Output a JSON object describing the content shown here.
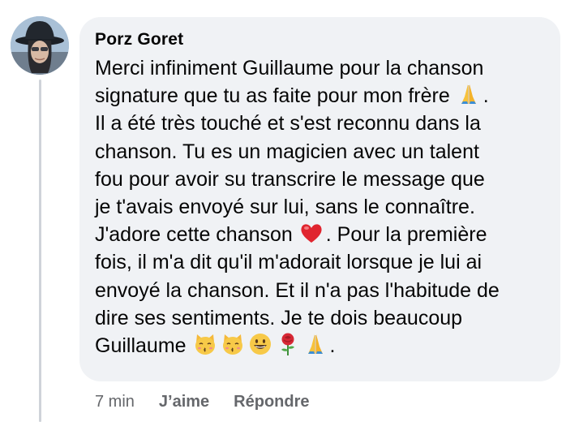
{
  "comment": {
    "author": "Porz Goret",
    "lines": [
      [
        "Merci infiniment Guillaume pour la chanson"
      ],
      [
        "signature que tu as faite pour mon frère ",
        {
          "emoji": "folded-hands"
        },
        "."
      ],
      [
        "Il a été très touché et s'est reconnu dans la"
      ],
      [
        "chanson. Tu es un magicien avec un talent"
      ],
      [
        "fou pour avoir su transcrire le message que"
      ],
      [
        "je t'avais envoyé sur lui, sans le connaître."
      ],
      [
        "J'adore cette chanson ",
        {
          "emoji": "red-heart"
        },
        ". Pour la première"
      ],
      [
        "fois, il m'a dit qu'il m'adorait lorsque je lui ai"
      ],
      [
        "envoyé la chanson. Et il n'a pas l'habitude de"
      ],
      [
        "dire ses sentiments. Je te dois beaucoup"
      ],
      [
        "Guillaume ",
        {
          "emoji": "kissing-cat"
        },
        {
          "emoji": "kissing-cat"
        },
        {
          "emoji": "grinning-face"
        },
        {
          "emoji": "rose"
        },
        {
          "emoji": "folded-hands"
        },
        "."
      ]
    ]
  },
  "actions": {
    "timestamp": "7 min",
    "like_label": "J’aime",
    "reply_label": "Répondre"
  },
  "colors": {
    "bubble_background": "#f0f2f5",
    "meta_text": "#65676b",
    "text": "#050505"
  }
}
